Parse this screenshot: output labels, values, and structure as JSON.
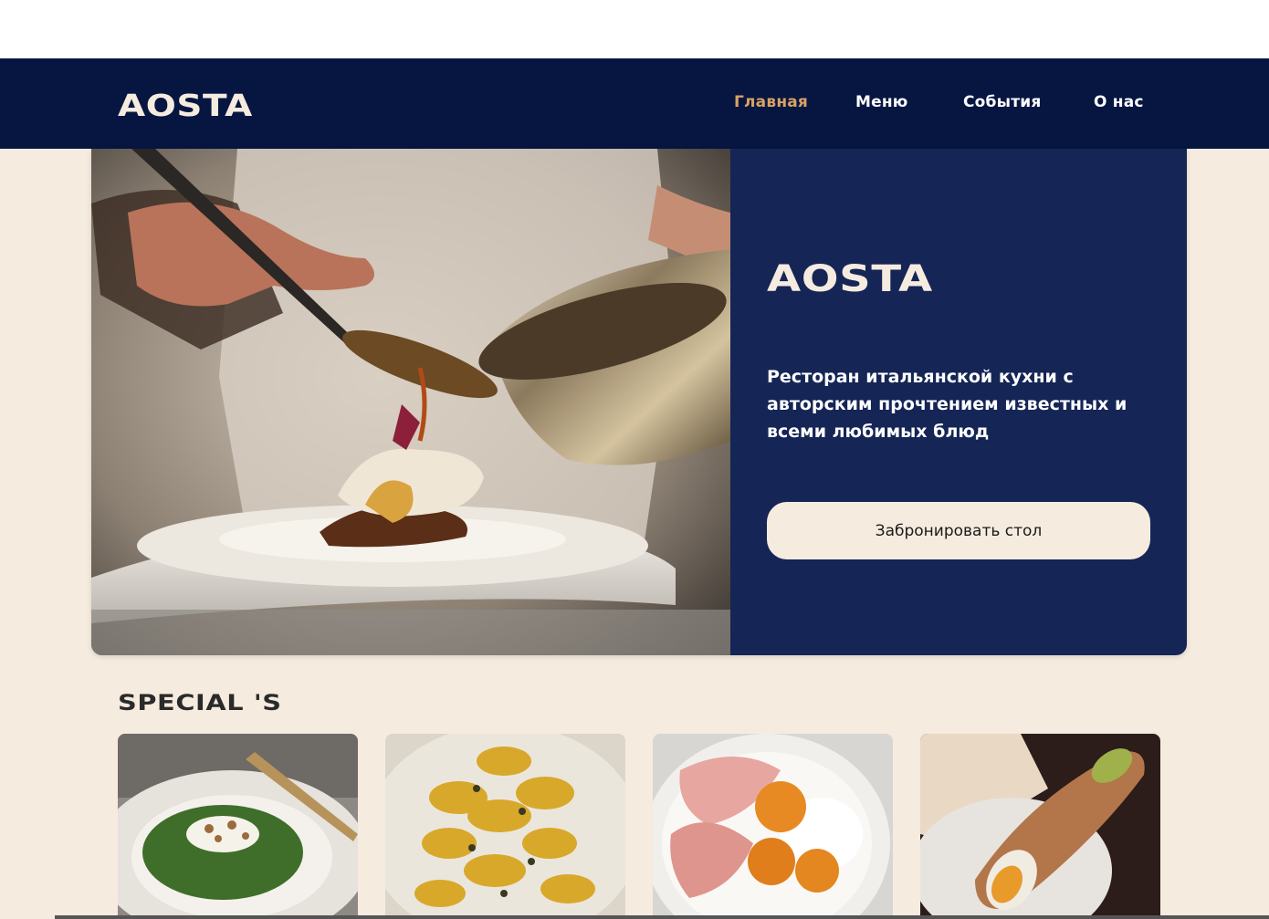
{
  "nav": {
    "logo": "AOSTA",
    "items": [
      {
        "label": "Главная",
        "active": true
      },
      {
        "label": "Меню",
        "active": false
      },
      {
        "label": "События",
        "active": false
      },
      {
        "label": "О нас",
        "active": false
      }
    ]
  },
  "hero": {
    "title": "AOSTA",
    "description": "Ресторан итальянской кухни с авторским прочтением известных и всеми любимых блюд",
    "button_label": "Забронировать стол"
  },
  "specials": {
    "title": "SPECIAL 'S",
    "cards": [
      {
        "image": "green-risotto-with-burrata-and-nuts"
      },
      {
        "image": "filled-pasta-with-pine-nuts"
      },
      {
        "image": "prosciutto-with-apricots-and-cheese"
      },
      {
        "image": "cannoli-with-pistachio"
      }
    ]
  },
  "colors": {
    "navbar": "#061641",
    "hero_panel": "#142556",
    "cream": "#f6ebdf",
    "accent": "#d7a263"
  }
}
